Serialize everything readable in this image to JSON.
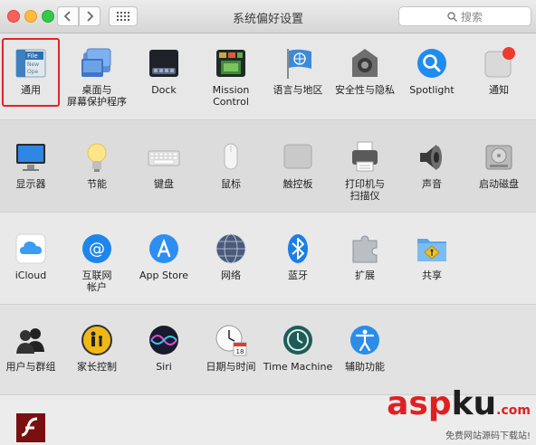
{
  "window": {
    "title": "系统偏好设置",
    "search_placeholder": "搜索"
  },
  "rows": [
    [
      {
        "name": "general",
        "label": "通用",
        "icon": "general-icon",
        "selected": true
      },
      {
        "name": "desktop-screensaver",
        "label": "桌面与\n屏幕保护程序",
        "icon": "desktop-screensaver-icon"
      },
      {
        "name": "dock",
        "label": "Dock",
        "icon": "dock-icon"
      },
      {
        "name": "mission-control",
        "label": "Mission\nControl",
        "icon": "mission-control-icon"
      },
      {
        "name": "language-region",
        "label": "语言与地区",
        "icon": "language-region-icon"
      },
      {
        "name": "security-privacy",
        "label": "安全性与隐私",
        "icon": "security-privacy-icon"
      },
      {
        "name": "spotlight",
        "label": "Spotlight",
        "icon": "spotlight-icon"
      },
      {
        "name": "notifications",
        "label": "通知",
        "icon": "notifications-icon"
      }
    ],
    [
      {
        "name": "displays",
        "label": "显示器",
        "icon": "display-icon"
      },
      {
        "name": "energy-saver",
        "label": "节能",
        "icon": "energy-saver-icon"
      },
      {
        "name": "keyboard",
        "label": "键盘",
        "icon": "keyboard-icon"
      },
      {
        "name": "mouse",
        "label": "鼠标",
        "icon": "mouse-icon"
      },
      {
        "name": "trackpad",
        "label": "触控板",
        "icon": "trackpad-icon"
      },
      {
        "name": "printers-scanners",
        "label": "打印机与\n扫描仪",
        "icon": "printer-icon"
      },
      {
        "name": "sound",
        "label": "声音",
        "icon": "sound-icon"
      },
      {
        "name": "startup-disk",
        "label": "启动磁盘",
        "icon": "startup-disk-icon"
      }
    ],
    [
      {
        "name": "icloud",
        "label": "iCloud",
        "icon": "icloud-icon"
      },
      {
        "name": "internet-accounts",
        "label": "互联网\n帐户",
        "icon": "internet-accounts-icon"
      },
      {
        "name": "app-store",
        "label": "App Store",
        "icon": "app-store-icon"
      },
      {
        "name": "network",
        "label": "网络",
        "icon": "network-icon"
      },
      {
        "name": "bluetooth",
        "label": "蓝牙",
        "icon": "bluetooth-icon"
      },
      {
        "name": "extensions",
        "label": "扩展",
        "icon": "extensions-icon"
      },
      {
        "name": "sharing",
        "label": "共享",
        "icon": "sharing-icon"
      }
    ],
    [
      {
        "name": "users-groups",
        "label": "用户与群组",
        "icon": "users-groups-icon"
      },
      {
        "name": "parental-controls",
        "label": "家长控制",
        "icon": "parental-controls-icon"
      },
      {
        "name": "siri",
        "label": "Siri",
        "icon": "siri-icon"
      },
      {
        "name": "date-time",
        "label": "日期与时间",
        "icon": "date-time-icon"
      },
      {
        "name": "time-machine",
        "label": "Time Machine",
        "icon": "time-machine-icon"
      },
      {
        "name": "accessibility",
        "label": "辅助功能",
        "icon": "accessibility-icon"
      }
    ],
    [
      {
        "name": "flash-player",
        "label": "",
        "icon": "flash-player-icon"
      }
    ]
  ],
  "icon_text": {
    "general_file": "File",
    "general_new": "New",
    "general_ope": "Ope",
    "calendar_day": "18"
  },
  "watermark": {
    "asp": "asp",
    "ku": "ku",
    "com": ".com",
    "tagline": "免费网站源码下载站!"
  },
  "colors": {
    "selection_border": "#e0242c",
    "close": "#fc605c",
    "minimize": "#fdbc40",
    "zoom": "#34c84a",
    "watermark_red": "#e02020"
  }
}
